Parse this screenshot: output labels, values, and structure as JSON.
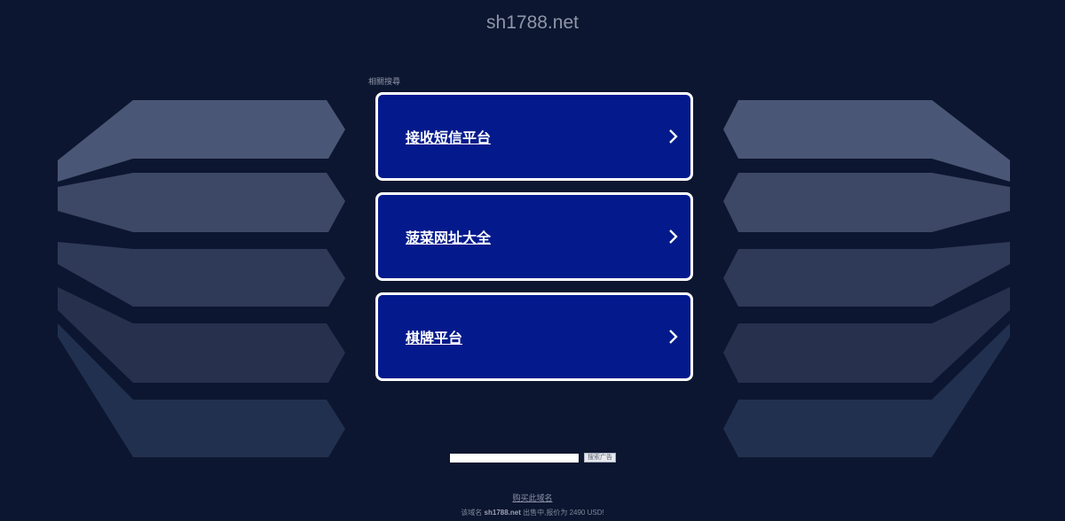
{
  "page": {
    "domain_title": "sh1788.net",
    "related_label": "相關搜尋"
  },
  "links": [
    {
      "label": "接收短信平台",
      "icon": "chevron-right-icon"
    },
    {
      "label": "菠菜网址大全",
      "icon": "chevron-right-icon"
    },
    {
      "label": "棋牌平台",
      "icon": "chevron-right-icon"
    }
  ],
  "search": {
    "value": "",
    "placeholder": "",
    "button_label": "搜索广告"
  },
  "footer": {
    "buy_label": "购买此域名",
    "sale_prefix": "该域名",
    "sale_domain": "sh1788.net",
    "sale_suffix": "出售中,报价为 2490 USD!"
  },
  "colors": {
    "background": "#0d1630",
    "card_fill": "#041a8c",
    "card_border": "#ffffff",
    "title_text": "#8f96a8",
    "decor_bands": [
      "#4a5675",
      "#3d4866",
      "#2f3a58",
      "#27304c",
      "#22304f"
    ]
  }
}
